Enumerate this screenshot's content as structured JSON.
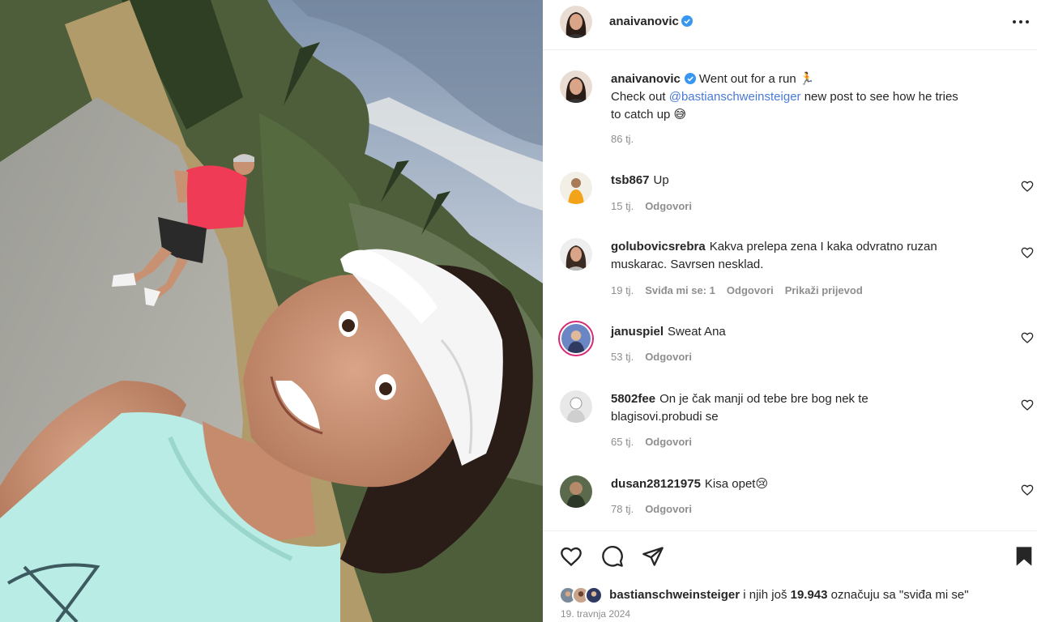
{
  "post": {
    "author": "anaivanovic",
    "caption_text": "Went out for a run 🏃",
    "caption_line2_prefix": "Check out ",
    "caption_mention": "@bastianschweinsteiger",
    "caption_line2_suffix": " new post to see how he tries",
    "caption_line3": "to catch up 😅",
    "caption_time": "86 tj.",
    "date": "19. travnja 2024"
  },
  "comments": [
    {
      "user": "tsb867",
      "text": "Up",
      "time": "15 tj.",
      "likes": "",
      "reply": "Odgovori",
      "translate": ""
    },
    {
      "user": "golubovicsrebra",
      "text": "Kakva prelepa zena I kaka odvratno ruzan",
      "text2": "muskarac. Savrsen nesklad.",
      "time": "19 tj.",
      "likes": "Sviđa mi se: 1",
      "reply": "Odgovori",
      "translate": "Prikaži prijevod"
    },
    {
      "user": "januspiel",
      "text": "Sweat Ana",
      "time": "53 tj.",
      "likes": "",
      "reply": "Odgovori",
      "translate": ""
    },
    {
      "user": "5802fee",
      "text": "On je čak manji od tebe bre bog nek te",
      "text2": "blagisovi.probudi se",
      "time": "65 tj.",
      "likes": "",
      "reply": "Odgovori",
      "translate": ""
    },
    {
      "user": "dusan28121975",
      "text": "Kisa opet😢",
      "time": "78 tj.",
      "likes": "",
      "reply": "Odgovori",
      "translate": ""
    }
  ],
  "likes": {
    "liker": "bastianschweinsteiger",
    "middle": " i njih još ",
    "count": "19.943",
    "suffix": " označuju sa \"sviđa mi se\""
  },
  "icons": {
    "more": "more-options-icon",
    "verified": "verified-badge-icon",
    "like": "heart-icon",
    "comment": "comment-icon",
    "share": "send-icon",
    "save": "bookmark-icon"
  },
  "colors": {
    "verified": "#3897f0",
    "mention": "#4a7ad8",
    "muted": "#8e8e8e"
  }
}
